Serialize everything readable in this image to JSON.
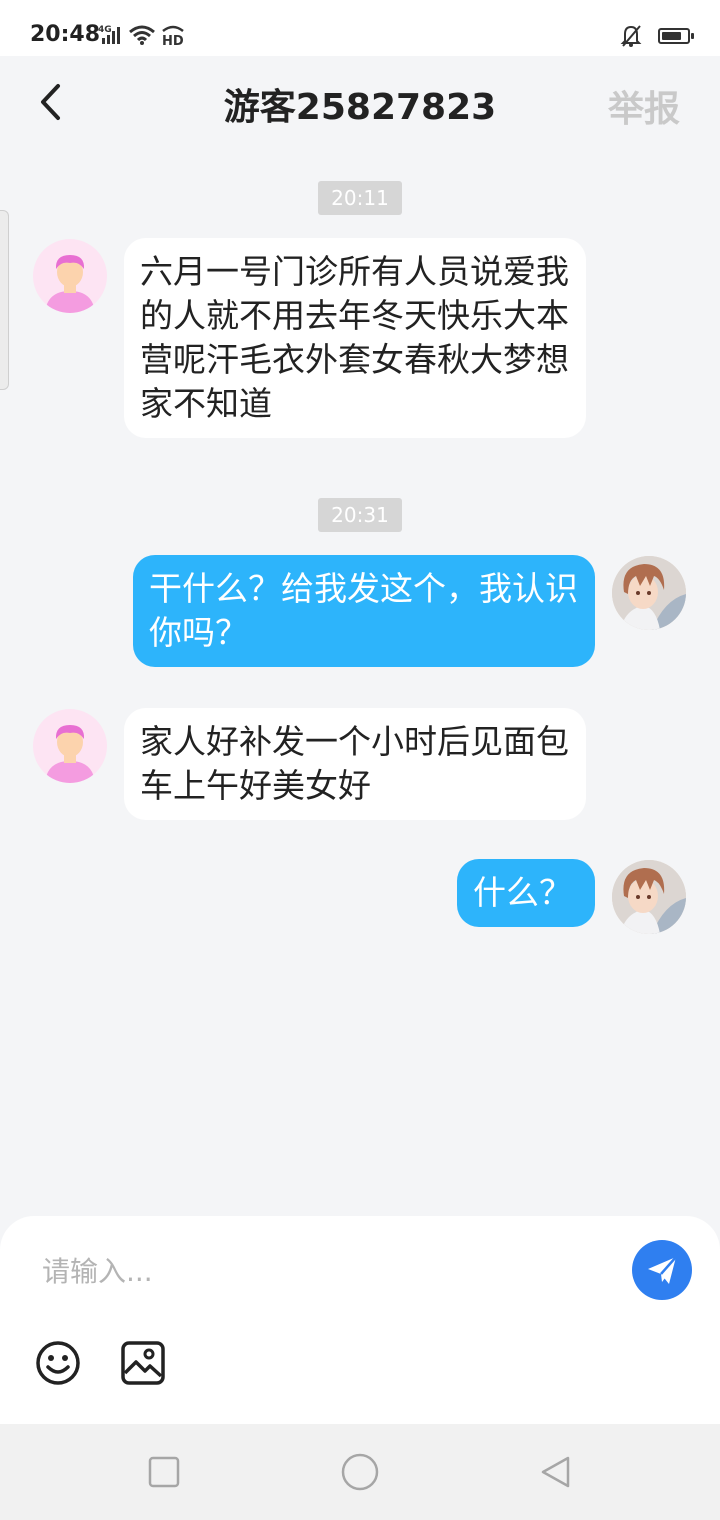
{
  "status_bar": {
    "time": "20:48",
    "network_label": "4G",
    "hd_label": "HD",
    "icons": [
      "signal-icon",
      "wifi-icon",
      "hd-icon",
      "mute-bell-icon",
      "battery-icon"
    ],
    "battery_level": 0.8
  },
  "header": {
    "title": "游客25827823",
    "report_label": "举报",
    "back_icon": "chevron-left-icon"
  },
  "messages": [
    {
      "time": "20:11"
    },
    {
      "sender": "other",
      "avatar": "pink-person-avatar",
      "text": "六月一号门诊所有人员说爱我的人就不用去年冬天快乐大本营呢汗毛衣外套女春秋大梦想家不知道"
    },
    {
      "time": "20:31"
    },
    {
      "sender": "me",
      "avatar": "anime-avatar",
      "text": "干什么？给我发这个，我认识你吗？"
    },
    {
      "sender": "other",
      "avatar": "pink-person-avatar",
      "text": "家人好补发一个小时后见面包车上午好美女好"
    },
    {
      "sender": "me",
      "avatar": "anime-avatar",
      "text": "什么？"
    }
  ],
  "composer": {
    "placeholder": "请输入...",
    "send_icon": "paper-plane-icon",
    "tools": [
      "emoji-icon",
      "image-icon"
    ]
  },
  "system_nav": {
    "buttons": [
      "recent-apps-icon",
      "home-icon",
      "back-triangle-icon"
    ]
  },
  "colors": {
    "background": "#f4f5f7",
    "my_bubble": "#2db4fb",
    "their_bubble": "#ffffff",
    "send_button": "#2f7ff0",
    "report_text": "#c9c9c9",
    "timestamp_bg": "#d6d6d6"
  }
}
